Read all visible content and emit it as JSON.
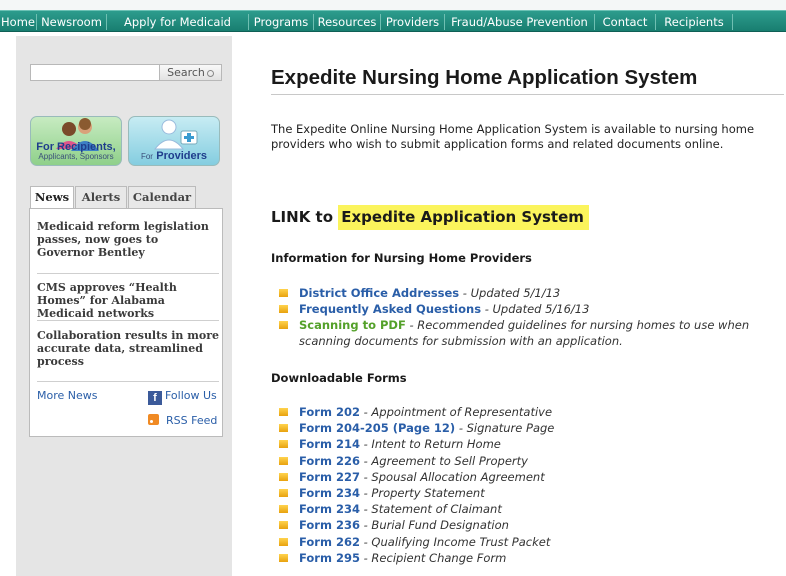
{
  "nav": {
    "items": [
      "Home",
      "Newsroom",
      "Apply for Medicaid",
      "Programs",
      "Resources",
      "Providers",
      "Fraud/Abuse Prevention",
      "Contact",
      "Recipients"
    ]
  },
  "sidebar": {
    "search": {
      "value": "",
      "button_label": "Search"
    },
    "tiles": {
      "recipients": {
        "line1": "For Recipients,",
        "line2": "Applicants, Sponsors"
      },
      "providers": {
        "prefix": "For",
        "label": "Providers"
      }
    },
    "tabs": [
      "News",
      "Alerts",
      "Calendar"
    ],
    "news": [
      "Medicaid reform legislation passes, now goes to Governor Bentley",
      "CMS approves “Health Homes” for Alabama Medicaid networks",
      "Collaboration results in more accurate data, streamlined process"
    ],
    "more_news": "More News",
    "follow_us": "Follow Us",
    "rss_feed": "RSS Feed"
  },
  "main": {
    "title": "Expedite Nursing Home Application System",
    "intro": "The Expedite Online Nursing Home Application System is available to nursing home providers who wish to submit application forms and related documents online.",
    "link_prefix": "LINK to",
    "link_text": "Expedite Application System",
    "info_heading": "Information for Nursing Home Providers",
    "info_items": [
      {
        "link": "District Office Addresses",
        "desc": " - Updated 5/1/13"
      },
      {
        "link": "Frequently Asked Questions",
        "desc": " - Updated 5/16/13"
      },
      {
        "link": "Scanning to PDF",
        "desc": " - Recommended guidelines for nursing homes to use when",
        "desc2": "scanning documents for submission with an application."
      }
    ],
    "forms_heading": "Downloadable Forms",
    "forms": [
      {
        "link": "Form 202",
        "desc": " - Appointment of Representative"
      },
      {
        "link": "Form 204-205 (Page 12)",
        "desc": " - Signature Page"
      },
      {
        "link": "Form 214",
        "desc": " - Intent to Return Home"
      },
      {
        "link": "Form 226",
        "desc": " - Agreement to Sell Property"
      },
      {
        "link": "Form 227",
        "desc": " - Spousal Allocation Agreement"
      },
      {
        "link": "Form 234",
        "desc": " - Property Statement"
      },
      {
        "link": "Form 234",
        "desc": " - Statement of Claimant"
      },
      {
        "link": "Form 236",
        "desc": " - Burial Fund Designation"
      },
      {
        "link": "Form 262",
        "desc": " - Qualifying Income Trust Packet"
      },
      {
        "link": "Form 295",
        "desc": " - Recipient Change Form"
      }
    ]
  },
  "colors": {
    "nav_bar": "#1f8a7b",
    "link_blue": "#2a5ea8",
    "link_green": "#54a12a",
    "highlight": "#fbf45c",
    "bullet": "#f0b020"
  }
}
